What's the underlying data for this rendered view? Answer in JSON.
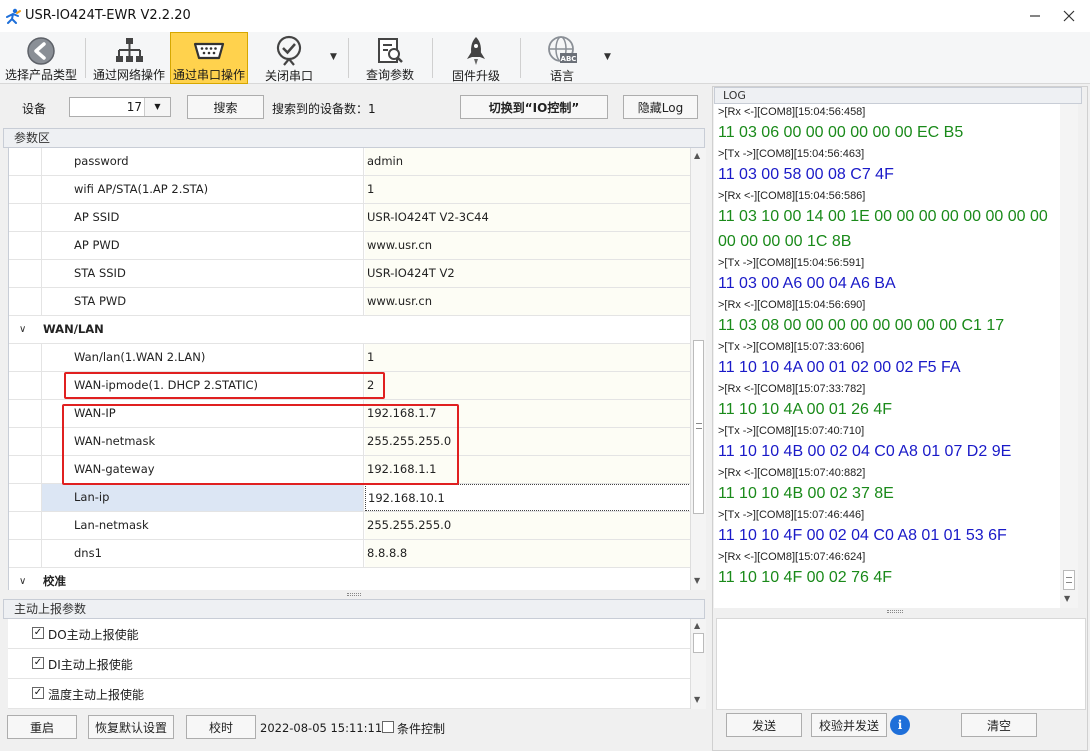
{
  "window": {
    "title": "USR-IO424T-EWR V2.2.20",
    "icon": "usr-logo-icon"
  },
  "toolbar": {
    "items": [
      {
        "label": "选择产品类型",
        "icon": "back-arrow-icon"
      },
      {
        "label": "通过网络操作",
        "icon": "network-icon"
      },
      {
        "label": "通过串口操作",
        "icon": "serial-port-icon",
        "active": true
      },
      {
        "label": "关闭串口",
        "icon": "check-badge-icon"
      },
      {
        "label": "查询参数",
        "icon": "query-document-icon"
      },
      {
        "label": "固件升级",
        "icon": "rocket-icon"
      },
      {
        "label": "语言",
        "icon": "globe-abc-icon"
      }
    ]
  },
  "devicebar": {
    "device_label": "设备",
    "device_value": "17",
    "search_button": "搜索",
    "found_text": "搜索到的设备数：1",
    "switch_button": "切换到“IO控制”",
    "hide_log_button": "隐藏Log"
  },
  "params": {
    "group_title": "参数区",
    "rows": [
      {
        "key": "password",
        "value": "admin"
      },
      {
        "key": "wifi AP/STA(1.AP 2.STA)",
        "value": "1"
      },
      {
        "key": "AP SSID",
        "value": "USR-IO424T V2-3C44"
      },
      {
        "key": "AP PWD",
        "value": "www.usr.cn"
      },
      {
        "key": "STA SSID",
        "value": "USR-IO424T V2"
      },
      {
        "key": "STA PWD",
        "value": "www.usr.cn"
      },
      {
        "section": "WAN/LAN"
      },
      {
        "key": "Wan/lan(1.WAN 2.LAN)",
        "value": "1"
      },
      {
        "key": "WAN-ipmode(1. DHCP 2.STATIC)",
        "value": "2"
      },
      {
        "key": "WAN-IP",
        "value": "192.168.1.7"
      },
      {
        "key": "WAN-netmask",
        "value": "255.255.255.0"
      },
      {
        "key": "WAN-gateway",
        "value": "192.168.1.1"
      },
      {
        "key": "Lan-ip",
        "value": "192.168.10.1",
        "selected": true
      },
      {
        "key": "Lan-netmask",
        "value": "255.255.255.0"
      },
      {
        "key": "dns1",
        "value": "8.8.8.8"
      },
      {
        "section": "校准"
      }
    ]
  },
  "report": {
    "group_title": "主动上报参数",
    "items": [
      {
        "label": "DO主动上报使能",
        "checked": true
      },
      {
        "label": "DI主动上报使能",
        "checked": true
      },
      {
        "label": "温度主动上报使能",
        "checked": true
      }
    ]
  },
  "bottombar": {
    "restart": "重启",
    "restore": "恢复默认设置",
    "sync_time": "校时",
    "datetime": "2022-08-05 15:11:11 5",
    "condition_control": "条件控制"
  },
  "log": {
    "title": "LOG",
    "lines": [
      {
        "type": "meta",
        "text": ">[Rx <-][COM8][15:04:56:458]"
      },
      {
        "type": "rx",
        "text": "11 03 06 00 00 00 00 00 00 EC B5"
      },
      {
        "type": "meta",
        "text": ">[Tx ->][COM8][15:04:56:463]"
      },
      {
        "type": "tx",
        "text": "11 03 00 58 00 08 C7 4F"
      },
      {
        "type": "meta",
        "text": ">[Rx <-][COM8][15:04:56:586]"
      },
      {
        "type": "rx",
        "text": "11 03 10 00 14 00 1E 00 00 00 00 00 00 00 00"
      },
      {
        "type": "rx",
        "text": "00 00 00 00 1C 8B"
      },
      {
        "type": "meta",
        "text": ">[Tx ->][COM8][15:04:56:591]"
      },
      {
        "type": "tx",
        "text": "11 03 00 A6 00 04 A6 BA"
      },
      {
        "type": "meta",
        "text": ">[Rx <-][COM8][15:04:56:690]"
      },
      {
        "type": "rx",
        "text": "11 03 08 00 00 00 00 00 00 00 00 C1 17"
      },
      {
        "type": "meta",
        "text": ">[Tx ->][COM8][15:07:33:606]"
      },
      {
        "type": "tx",
        "text": "11 10 10 4A 00 01 02 00 02 F5 FA"
      },
      {
        "type": "meta",
        "text": ">[Rx <-][COM8][15:07:33:782]"
      },
      {
        "type": "rx",
        "text": "11 10 10 4A 00 01 26 4F"
      },
      {
        "type": "meta",
        "text": ">[Tx ->][COM8][15:07:40:710]"
      },
      {
        "type": "tx",
        "text": "11 10 10 4B 00 02 04 C0 A8 01 07 D2 9E"
      },
      {
        "type": "meta",
        "text": ">[Rx <-][COM8][15:07:40:882]"
      },
      {
        "type": "rx",
        "text": "11 10 10 4B 00 02 37 8E"
      },
      {
        "type": "meta",
        "text": ">[Tx ->][COM8][15:07:46:446]"
      },
      {
        "type": "tx",
        "text": "11 10 10 4F 00 02 04 C0 A8 01 01 53 6F"
      },
      {
        "type": "meta",
        "text": ">[Rx <-][COM8][15:07:46:624]"
      },
      {
        "type": "rx",
        "text": "11 10 10 4F 00 02 76 4F"
      }
    ],
    "send_button": "发送",
    "verify_send_button": "校验并发送",
    "clear_button": "清空"
  },
  "colors": {
    "rx": "#1a8a1a",
    "tx": "#1a1ac8",
    "active_tool": "#ffd24d",
    "highlight": "#e02020"
  }
}
